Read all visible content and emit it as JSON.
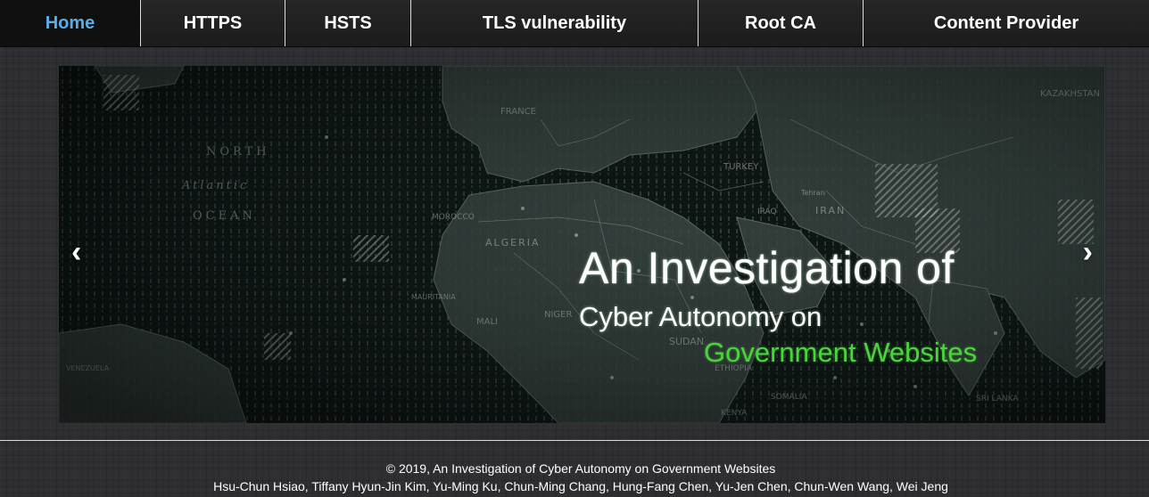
{
  "nav": {
    "items": [
      {
        "label": "Home",
        "active": true
      },
      {
        "label": "HTTPS",
        "active": false
      },
      {
        "label": "HSTS",
        "active": false
      },
      {
        "label": "TLS vulnerability",
        "active": false
      },
      {
        "label": "Root CA",
        "active": false
      },
      {
        "label": "Content Provider",
        "active": false
      }
    ],
    "active_color": "#5aaee8"
  },
  "carousel": {
    "prev_glyph": "‹",
    "next_glyph": "›",
    "caption": {
      "line1": "An Investigation of",
      "line2": "Cyber Autonomy on",
      "line3": "Government Websites",
      "highlight_color": "#49d63a"
    },
    "map_labels": [
      "NORTH",
      "ATLANTIC",
      "OCEAN",
      "FRANCE",
      "TURKEY",
      "IRAN",
      "KAZAKHSTAN",
      "MOROCCO",
      "ALGERIA",
      "MAURITANIA",
      "MALI",
      "NIGER",
      "SUDAN",
      "ETHIOPIA",
      "KENYA",
      "SOMALIA",
      "SRI LANKA",
      "IRAQ",
      "Tehran",
      "VENEZUELA"
    ]
  },
  "footer": {
    "line1": "© 2019, An Investigation of Cyber Autonomy on Government Websites",
    "line2": "Hsu-Chun Hsiao, Tiffany Hyun-Jin Kim, Yu-Ming Ku, Chun-Ming Chang, Hung-Fang Chen, Yu-Jen Chen, Chun-Wen Wang, Wei Jeng"
  }
}
